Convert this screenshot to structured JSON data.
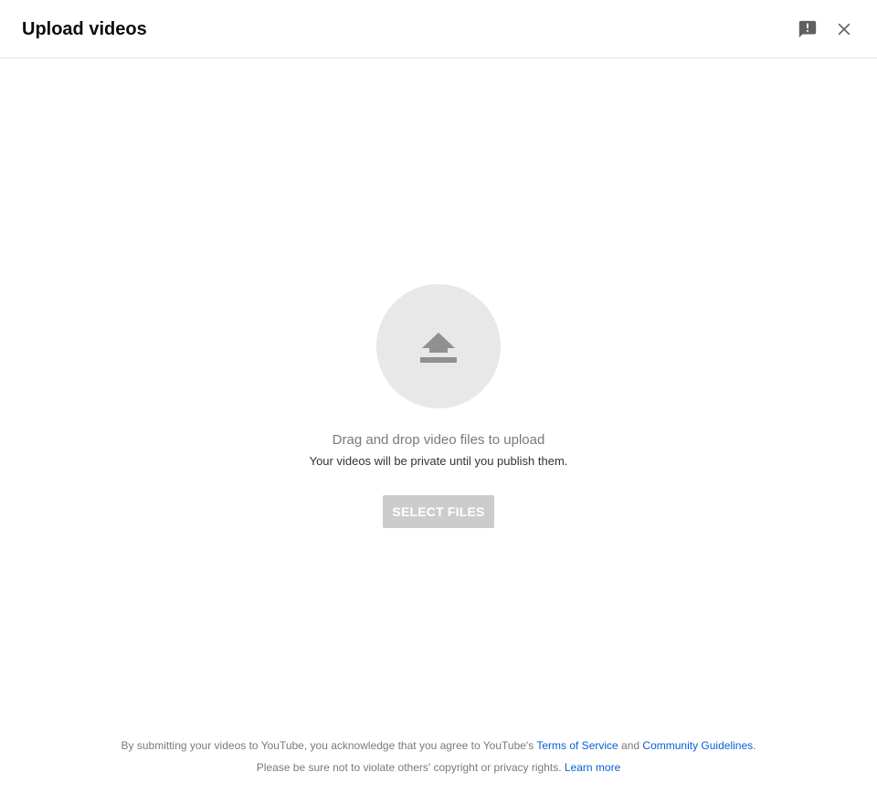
{
  "header": {
    "title": "Upload videos",
    "feedback_icon": "feedback-icon",
    "close_icon": "close-icon"
  },
  "drop_zone": {
    "icon": "upload-arrow-icon",
    "drag_text": "Drag and drop video files to upload",
    "private_text": "Your videos will be private until you publish them.",
    "select_button_label": "SELECT FILES"
  },
  "footer": {
    "line1_prefix": "By submitting your videos to YouTube, you acknowledge that you agree to YouTube's ",
    "terms_link": "Terms of Service",
    "line1_and": " and ",
    "guidelines_link": "Community Guidelines",
    "line1_suffix": ".",
    "line2_prefix": "Please be sure not to violate others' copyright or privacy rights. ",
    "learn_more_link": "Learn more"
  },
  "colors": {
    "link": "#065fd4",
    "button_disabled_bg": "#cccccc",
    "circle_bg": "#e8e8e8",
    "icon": "#909090"
  }
}
